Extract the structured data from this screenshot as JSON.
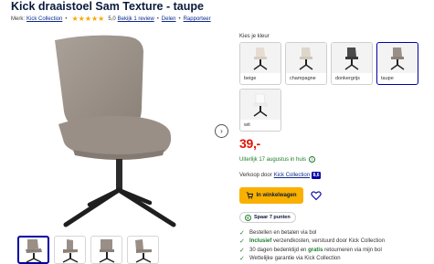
{
  "product": {
    "title": "Kick draaistoel Sam Texture - taupe",
    "brand_label": "Merk:",
    "brand": "Kick Collection",
    "rating_value": "5,0",
    "rating_stars": 5,
    "review_link": "Bekijk 1 review",
    "share_link": "Delen",
    "report_link": "Rapporteer"
  },
  "gallery": {
    "main_image": "chair-taupe",
    "next_button": "›",
    "thumbs": [
      "chair-front",
      "chair-side",
      "chair-back",
      "chair-angle"
    ]
  },
  "colors": {
    "label": "Kies je kleur",
    "options": [
      {
        "name": "beige",
        "shade": "#e6dcd2",
        "selected": false
      },
      {
        "name": "champagne",
        "shade": "#ddd6cb",
        "selected": false
      },
      {
        "name": "donkergrijs",
        "shade": "#4a4a4a",
        "selected": false
      },
      {
        "name": "taupe",
        "shade": "#9a8f86",
        "selected": true
      },
      {
        "name": "wit",
        "shade": "#f3f3f3",
        "selected": false
      }
    ]
  },
  "price": "39,-",
  "delivery": "Uiterlijk 17 augustus in huis",
  "seller": {
    "label": "Verkoop door",
    "name": "Kick Collection",
    "score": "8,6"
  },
  "cart_button": "In winkelwagen",
  "points": "Spaar 7 punten",
  "usps": [
    [
      "Bestellen en betalen via bol"
    ],
    [
      "Inclusief",
      " verzendkosten, verstuurd door Kick Collection"
    ],
    [
      "30 dagen bedenktijd en ",
      "gratis",
      " retourneren via mijn bol"
    ],
    [
      "Wettelijke garantie via Kick Collection"
    ]
  ],
  "colors_theme": {
    "accent": "#0000a4",
    "price": "#e01300",
    "cta": "#f9b000",
    "success": "#1c7c2c"
  }
}
